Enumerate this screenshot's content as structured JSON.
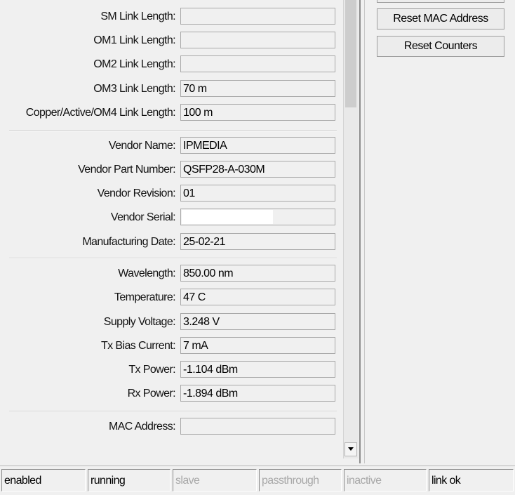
{
  "fields": [
    {
      "label": "SM Link Length:",
      "value": ""
    },
    {
      "label": "OM1 Link Length:",
      "value": ""
    },
    {
      "label": "OM2 Link Length:",
      "value": ""
    },
    {
      "label": "OM3 Link Length:",
      "value": "70 m"
    },
    {
      "label": "Copper/Active/OM4 Link Length:",
      "value": "100 m"
    },
    {
      "label": "Vendor Name:",
      "value": "IPMEDIA"
    },
    {
      "label": "Vendor Part Number:",
      "value": "QSFP28-A-030M"
    },
    {
      "label": "Vendor Revision:",
      "value": "01"
    },
    {
      "label": "Vendor Serial:",
      "value": ""
    },
    {
      "label": "Manufacturing Date:",
      "value": "25-02-21"
    },
    {
      "label": "Wavelength:",
      "value": "850.00 nm"
    },
    {
      "label": "Temperature:",
      "value": "47 C"
    },
    {
      "label": "Supply Voltage:",
      "value": "3.248 V"
    },
    {
      "label": "Tx Bias Current:",
      "value": "7 mA"
    },
    {
      "label": "Tx Power:",
      "value": "-1.104 dBm"
    },
    {
      "label": "Rx Power:",
      "value": "-1.894 dBm"
    },
    {
      "label": "MAC Address:",
      "value": ""
    }
  ],
  "buttons": {
    "reset_mac": "Reset MAC Address",
    "reset_counters": "Reset Counters"
  },
  "status": [
    "enabled",
    "running",
    "slave",
    "passthrough",
    "inactive",
    "link ok"
  ]
}
